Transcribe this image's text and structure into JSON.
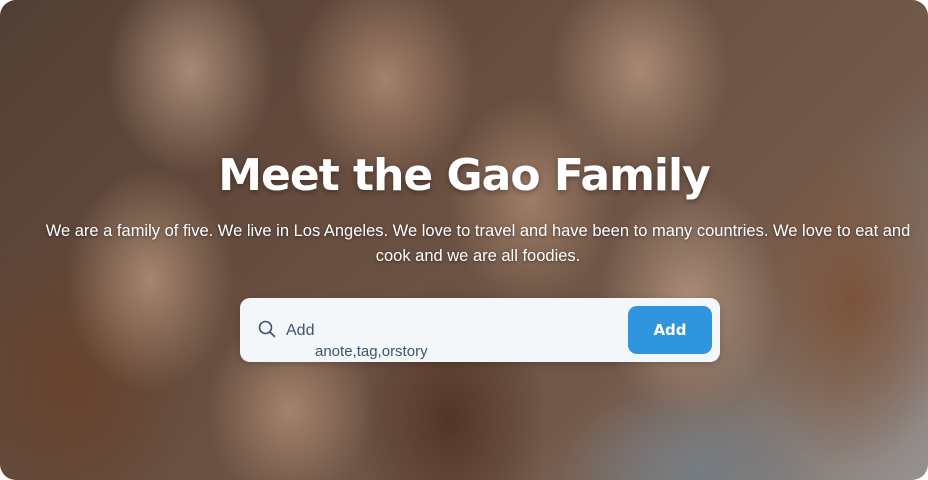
{
  "hero": {
    "title": "Meet the Gao Family",
    "subtitle": "We are a family of five. We live in Los Angeles. We love to travel and have been to many countries. We love to eat and cook and we are all foodies."
  },
  "search": {
    "value": "Add",
    "hint": "anote,tag,orstory",
    "button_label": "Add",
    "icon": "search-icon"
  },
  "colors": {
    "accent": "#2f95df",
    "input_text": "#3c556b",
    "searchbar_bg": "#f4f7f9"
  }
}
